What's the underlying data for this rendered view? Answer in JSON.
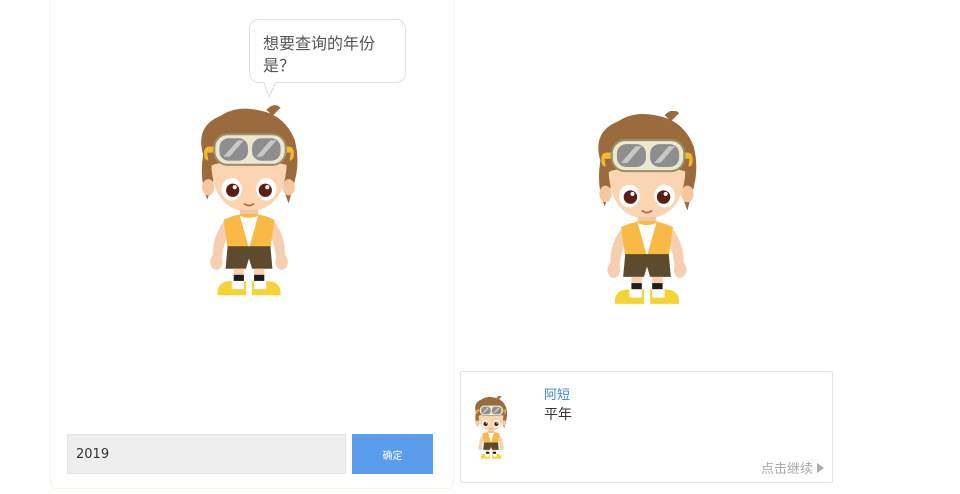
{
  "question": {
    "text": "想要查询的年份是？"
  },
  "input": {
    "value": "2019",
    "placeholder": ""
  },
  "confirm": {
    "label": "确定"
  },
  "dialog": {
    "speaker": "阿短",
    "text": "平年",
    "continue_label": "点击继续"
  },
  "colors": {
    "accent": "#5c9ced",
    "speaker": "#3f86d1",
    "input_bg": "#eeeeee"
  }
}
